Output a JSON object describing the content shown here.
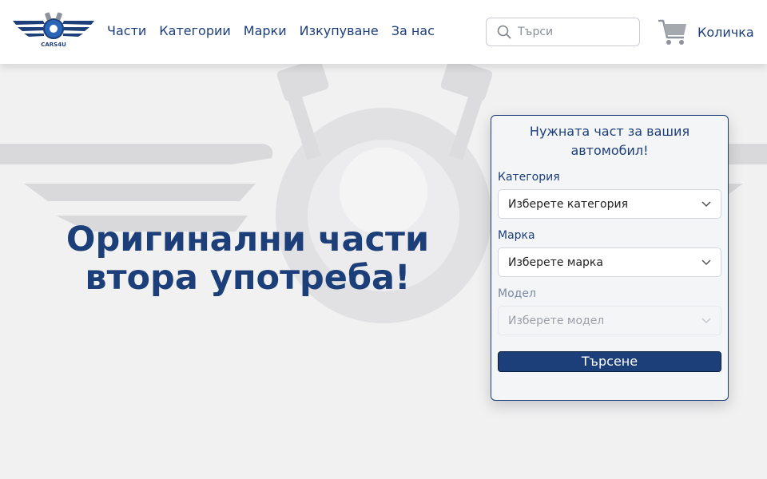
{
  "brand": {
    "logo_text": "CARS4U"
  },
  "nav": {
    "items": [
      "Части",
      "Категории",
      "Марки",
      "Изкупуване",
      "За нас"
    ]
  },
  "search": {
    "placeholder": "Търси",
    "value": ""
  },
  "cart": {
    "label": "Количка"
  },
  "hero": {
    "line1": "Оригинални части",
    "line2": "втора употреба!"
  },
  "finder": {
    "title": "Нужната част за вашия автомобил!",
    "category": {
      "label": "Категория",
      "selected": "Изберете категория"
    },
    "brand": {
      "label": "Марка",
      "selected": "Изберете марка"
    },
    "model": {
      "label": "Модел",
      "selected": "Изберете модел",
      "disabled": true
    },
    "submit_label": "Търсене"
  },
  "colors": {
    "primary": "#1c3f7a",
    "background": "#f1f1f2",
    "header": "#ffffff"
  },
  "icons": {
    "search": "magnifier-icon",
    "cart": "shopping-cart-icon",
    "chevron": "chevron-down-icon"
  }
}
